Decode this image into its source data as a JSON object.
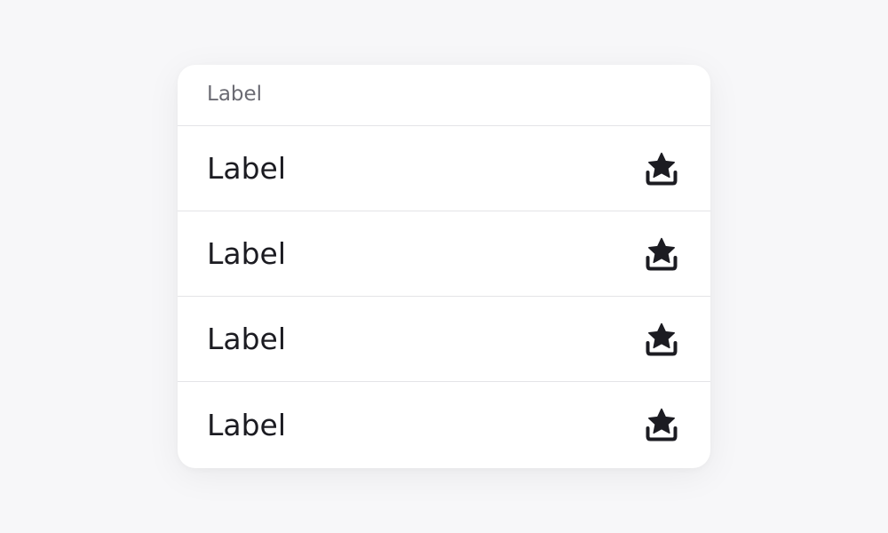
{
  "list": {
    "header_label": "Label",
    "items": [
      {
        "label": "Label",
        "icon": "star-inbox-icon"
      },
      {
        "label": "Label",
        "icon": "star-inbox-icon"
      },
      {
        "label": "Label",
        "icon": "star-inbox-icon"
      },
      {
        "label": "Label",
        "icon": "star-inbox-icon"
      }
    ]
  },
  "colors": {
    "background": "#f7f7f9",
    "card": "#ffffff",
    "divider": "#e4e4e7",
    "header_text": "#6b6b73",
    "item_text": "#1c1c22",
    "icon": "#1c1c22"
  }
}
